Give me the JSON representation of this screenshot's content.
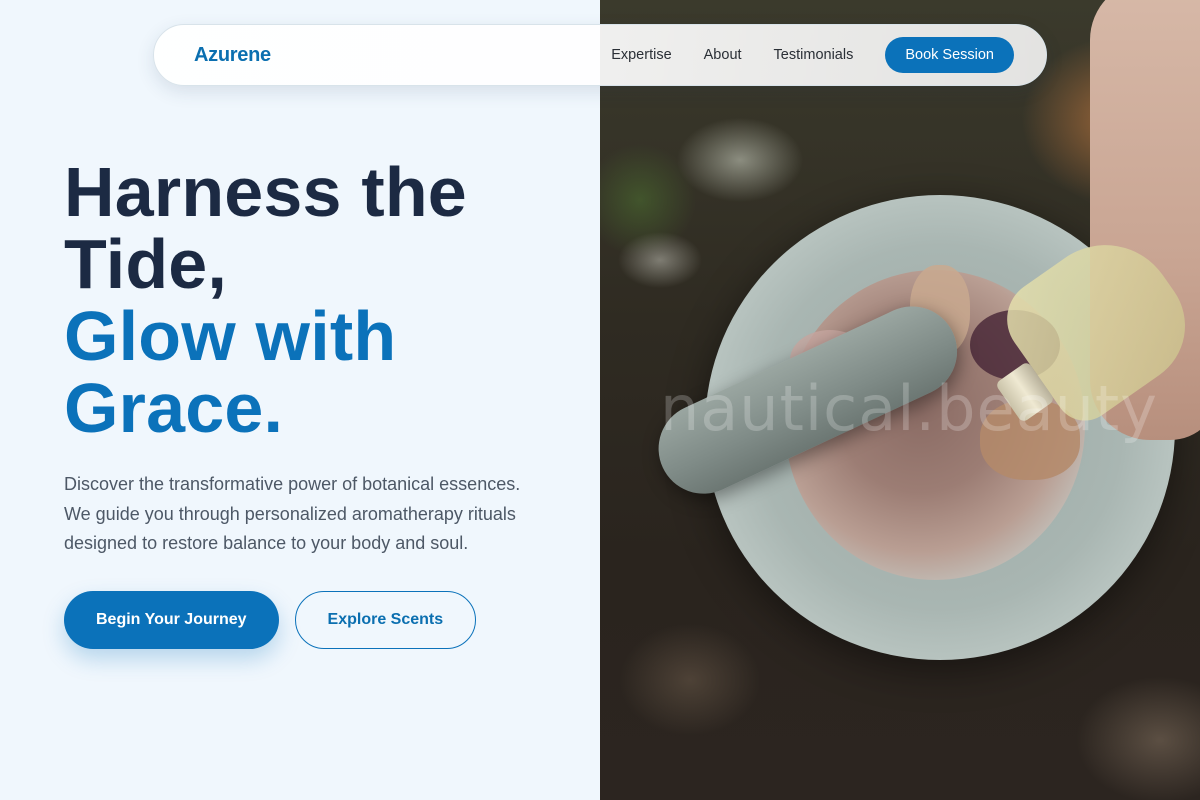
{
  "nav": {
    "brand": "Azurene",
    "links": [
      "Expertise",
      "About",
      "Testimonials"
    ],
    "cta": "Book Session"
  },
  "hero": {
    "headline_line1": "Harness the",
    "headline_line2": "Tide,",
    "headline_accent_line1": "Glow with",
    "headline_accent_line2": "Grace.",
    "description_lines": [
      "Discover the transformative power of botanical essences.",
      "We guide you through personalized aromatherapy rituals",
      "designed to restore balance to your body and soul."
    ],
    "primary_cta": "Begin Your Journey",
    "secondary_cta": "Explore Scents"
  },
  "image": {
    "watermark": "nautical.beauty"
  },
  "colors": {
    "accent": "#0b72ba",
    "heading": "#1c2a43",
    "background": "#f0f7fd"
  }
}
